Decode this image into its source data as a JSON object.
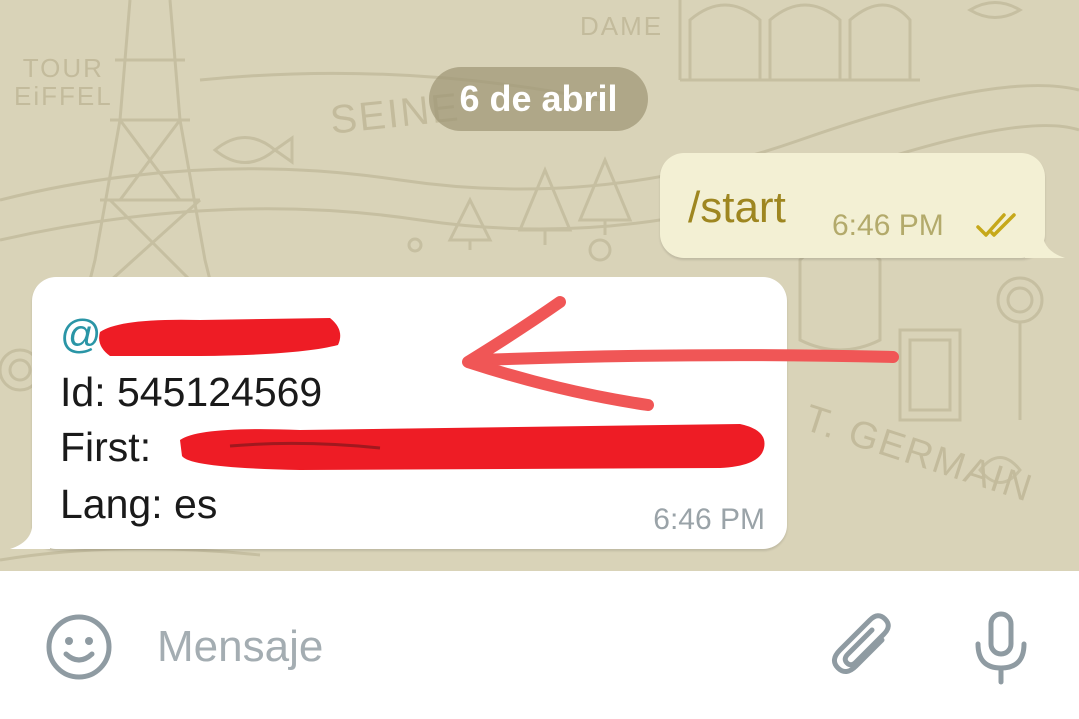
{
  "date_separator": "6 de abril",
  "wallpaper_text": {
    "tower": "TOUR\nEiFFEL",
    "dame": "DAME",
    "seine": "SEINE",
    "germain": "T. GERMAIN"
  },
  "outgoing_message": {
    "text": "/start",
    "time": "6:46 PM",
    "status_icon": "double-check-icon"
  },
  "incoming_message": {
    "mention_prefix": "@",
    "id_label": "Id:",
    "id_value": "545124569",
    "first_label": "First:",
    "lang_label": "Lang:",
    "lang_value": "es",
    "time": "6:46 PM"
  },
  "input": {
    "placeholder": "Mensaje",
    "emoji_icon": "emoji-icon",
    "attach_icon": "paperclip-icon",
    "mic_icon": "microphone-icon"
  },
  "colors": {
    "wallpaper": "#d9d3b8",
    "outgoing_bubble": "#f3f0d4",
    "outgoing_text": "#9e8620",
    "mention": "#2a95a6",
    "redaction": "#ee1c25",
    "arrow": "#f05656"
  }
}
